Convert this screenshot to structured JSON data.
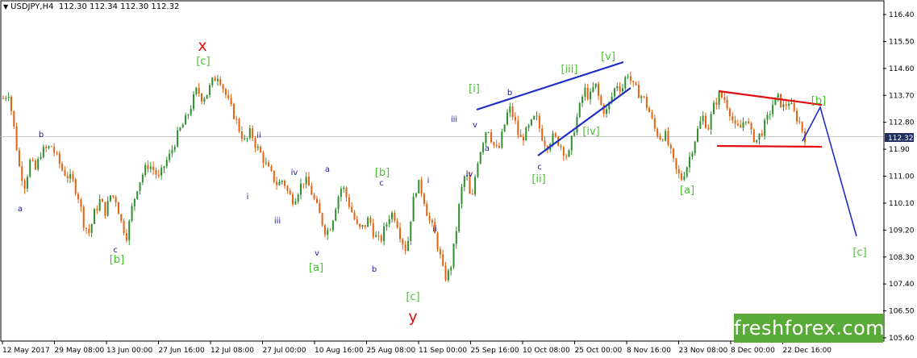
{
  "header": {
    "symbol": "USDJPY,H4",
    "open": "112.30",
    "high": "112.34",
    "low": "112.30",
    "close": "112.32"
  },
  "brand": "freshforex.com",
  "colors": {
    "up_candle": "#2f8f2f",
    "down_candle": "#e3620f",
    "wave_minor": "#1a1aa0",
    "wave_green": "#45c22d",
    "wave_red": "#e01010",
    "trend_blue": "#1d2ec9",
    "trend_red": "#e01010",
    "price_tag_bg": "#1f2d60"
  },
  "chart_data": {
    "type": "candlestick",
    "y_ticks": [
      "116.40",
      "115.50",
      "114.60",
      "113.70",
      "112.80",
      "11.90",
      "111.00",
      "110.10",
      "109.20",
      "108.30",
      "107.40",
      "106.50",
      "105.60"
    ],
    "y_tick_values": [
      116.4,
      115.5,
      114.6,
      113.7,
      112.8,
      111.9,
      111.0,
      110.1,
      109.2,
      108.3,
      107.4,
      106.5,
      105.6
    ],
    "ylim": [
      105.45,
      116.7
    ],
    "x_labels": [
      "12 May 2017",
      "29 May 08:00",
      "13 Jun 00:00",
      "27 Jun 16:00",
      "12 Jul 08:00",
      "27 Jul 00:00",
      "10 Aug 16:00",
      "25 Aug 08:00",
      "11 Sep 00:00",
      "25 Sep 16:00",
      "10 Oct 08:00",
      "25 Oct 00:00",
      "8 Nov 16:00",
      "23 Nov 08:00",
      "8 Dec 00:00",
      "22 Dec 16:00"
    ],
    "current_price": "112.32",
    "price_path": [
      [
        0,
        113.6
      ],
      [
        1,
        113.8
      ],
      [
        2,
        112.6
      ],
      [
        3,
        111.3
      ],
      [
        4,
        110.7
      ],
      [
        5,
        111.5
      ],
      [
        6,
        111.2
      ],
      [
        7,
        111.8
      ],
      [
        8,
        111.9
      ],
      [
        9,
        112.0
      ],
      [
        10,
        111.6
      ],
      [
        11,
        111.2
      ],
      [
        12,
        111.0
      ],
      [
        13,
        110.8
      ],
      [
        14,
        110.3
      ],
      [
        15,
        109.4
      ],
      [
        16,
        109.1
      ],
      [
        17,
        109.8
      ],
      [
        18,
        110.2
      ],
      [
        19,
        109.8
      ],
      [
        20,
        110.4
      ],
      [
        21,
        110.2
      ],
      [
        22,
        109.4
      ],
      [
        23,
        109.0
      ],
      [
        24,
        110.0
      ],
      [
        25,
        110.7
      ],
      [
        26,
        111.1
      ],
      [
        27,
        111.4
      ],
      [
        28,
        111.2
      ],
      [
        29,
        110.9
      ],
      [
        30,
        111.4
      ],
      [
        31,
        111.7
      ],
      [
        32,
        112.2
      ],
      [
        33,
        112.6
      ],
      [
        34,
        112.9
      ],
      [
        35,
        113.4
      ],
      [
        36,
        113.9
      ],
      [
        37,
        113.6
      ],
      [
        38,
        113.8
      ],
      [
        39,
        114.2
      ],
      [
        40,
        114.4
      ],
      [
        41,
        113.9
      ],
      [
        42,
        113.4
      ],
      [
        43,
        113.0
      ],
      [
        44,
        112.5
      ],
      [
        45,
        112.1
      ],
      [
        46,
        112.5
      ],
      [
        47,
        112.0
      ],
      [
        48,
        111.7
      ],
      [
        49,
        111.3
      ],
      [
        50,
        111.0
      ],
      [
        51,
        110.7
      ],
      [
        52,
        110.9
      ],
      [
        53,
        110.4
      ],
      [
        54,
        110.2
      ],
      [
        55,
        110.6
      ],
      [
        56,
        110.9
      ],
      [
        57,
        110.6
      ],
      [
        58,
        110.1
      ],
      [
        59,
        109.6
      ],
      [
        60,
        109.1
      ],
      [
        61,
        109.4
      ],
      [
        62,
        110.2
      ],
      [
        63,
        110.7
      ],
      [
        64,
        110.2
      ],
      [
        65,
        109.7
      ],
      [
        66,
        109.2
      ],
      [
        67,
        109.3
      ],
      [
        68,
        109.6
      ],
      [
        69,
        109.0
      ],
      [
        70,
        108.8
      ],
      [
        71,
        109.3
      ],
      [
        72,
        109.8
      ],
      [
        73,
        109.6
      ],
      [
        74,
        108.9
      ],
      [
        75,
        108.5
      ],
      [
        76,
        110.0
      ],
      [
        77,
        110.8
      ],
      [
        78,
        110.4
      ],
      [
        79,
        109.6
      ],
      [
        80,
        109.2
      ],
      [
        81,
        108.5
      ],
      [
        82,
        107.6
      ],
      [
        83,
        107.8
      ],
      [
        84,
        108.9
      ],
      [
        85,
        110.4
      ],
      [
        86,
        111.2
      ],
      [
        87,
        110.0
      ],
      [
        88,
        111.4
      ],
      [
        89,
        112.1
      ],
      [
        90,
        112.7
      ],
      [
        91,
        112.1
      ],
      [
        92,
        111.8
      ],
      [
        93,
        112.6
      ],
      [
        94,
        113.3
      ],
      [
        95,
        112.9
      ],
      [
        96,
        112.2
      ],
      [
        97,
        112.4
      ],
      [
        98,
        112.7
      ],
      [
        99,
        113.0
      ],
      [
        100,
        112.4
      ],
      [
        101,
        112.0
      ],
      [
        102,
        112.3
      ],
      [
        103,
        112.2
      ],
      [
        104,
        111.9
      ],
      [
        105,
        111.6
      ],
      [
        106,
        112.5
      ],
      [
        107,
        113.2
      ],
      [
        108,
        113.9
      ],
      [
        109,
        113.6
      ],
      [
        110,
        114.1
      ],
      [
        111,
        113.4
      ],
      [
        112,
        113.1
      ],
      [
        113,
        113.6
      ],
      [
        114,
        114.1
      ],
      [
        115,
        113.9
      ],
      [
        116,
        114.5
      ],
      [
        117,
        114.0
      ],
      [
        118,
        113.8
      ],
      [
        119,
        113.6
      ],
      [
        120,
        113.2
      ],
      [
        121,
        112.6
      ],
      [
        122,
        112.3
      ],
      [
        123,
        112.4
      ],
      [
        124,
        111.8
      ],
      [
        125,
        111.2
      ],
      [
        126,
        110.9
      ],
      [
        127,
        111.3
      ],
      [
        128,
        111.9
      ],
      [
        129,
        112.5
      ],
      [
        130,
        113.0
      ],
      [
        131,
        112.6
      ],
      [
        132,
        113.3
      ],
      [
        133,
        113.7
      ],
      [
        134,
        113.6
      ],
      [
        135,
        113.2
      ],
      [
        136,
        112.6
      ],
      [
        137,
        112.6
      ],
      [
        138,
        113.0
      ],
      [
        139,
        112.4
      ],
      [
        140,
        112.2
      ],
      [
        141,
        112.5
      ],
      [
        142,
        112.9
      ],
      [
        143,
        113.4
      ],
      [
        144,
        113.6
      ],
      [
        145,
        113.3
      ],
      [
        146,
        113.5
      ],
      [
        147,
        113.1
      ],
      [
        148,
        112.8
      ],
      [
        149,
        112.3
      ]
    ],
    "projection": [
      [
        995,
        175
      ],
      [
        1017,
        133
      ],
      [
        1062,
        293
      ]
    ],
    "wave_labels": [
      {
        "text": "x",
        "color": "red",
        "x": 251,
        "y": 63
      },
      {
        "text": "y",
        "color": "red",
        "x": 512,
        "y": 399
      },
      {
        "text": "[c]",
        "color": "green",
        "x": 252,
        "y": 80
      },
      {
        "text": "[b]",
        "color": "green",
        "x": 145,
        "y": 326
      },
      {
        "text": "[a]",
        "color": "green",
        "x": 392,
        "y": 336
      },
      {
        "text": "[b]",
        "color": "green",
        "x": 474,
        "y": 218
      },
      {
        "text": "[c]",
        "color": "green",
        "x": 512,
        "y": 372
      },
      {
        "text": "[i]",
        "color": "green",
        "x": 588,
        "y": 114
      },
      {
        "text": "[ii]",
        "color": "green",
        "x": 668,
        "y": 226
      },
      {
        "text": "[iii]",
        "color": "green",
        "x": 706,
        "y": 90
      },
      {
        "text": "[iv]",
        "color": "green",
        "x": 733,
        "y": 167
      },
      {
        "text": "[v]",
        "color": "green",
        "x": 754,
        "y": 74
      },
      {
        "text": "[a]",
        "color": "green",
        "x": 852,
        "y": 240
      },
      {
        "text": "[b]",
        "color": "green",
        "x": 1015,
        "y": 129
      },
      {
        "text": "[c]",
        "color": "green",
        "x": 1066,
        "y": 317
      },
      {
        "text": "a",
        "color": "blue",
        "x": 25,
        "y": 262
      },
      {
        "text": "b",
        "color": "blue",
        "x": 51,
        "y": 170
      },
      {
        "text": "c",
        "color": "blue",
        "x": 143,
        "y": 313
      },
      {
        "text": "i",
        "color": "blue",
        "x": 307,
        "y": 247
      },
      {
        "text": "ii",
        "color": "blue",
        "x": 321,
        "y": 171
      },
      {
        "text": "iii",
        "color": "blue",
        "x": 344,
        "y": 277
      },
      {
        "text": "iv",
        "color": "blue",
        "x": 365,
        "y": 217
      },
      {
        "text": "v",
        "color": "blue",
        "x": 393,
        "y": 317
      },
      {
        "text": "a",
        "color": "blue",
        "x": 406,
        "y": 213
      },
      {
        "text": "b",
        "color": "blue",
        "x": 464,
        "y": 337
      },
      {
        "text": "c",
        "color": "blue",
        "x": 473,
        "y": 230
      },
      {
        "text": "i",
        "color": "blue",
        "x": 531,
        "y": 227
      },
      {
        "text": "ii",
        "color": "blue",
        "x": 539,
        "y": 287
      },
      {
        "text": "iii",
        "color": "blue",
        "x": 563,
        "y": 151
      },
      {
        "text": "iv",
        "color": "blue",
        "x": 582,
        "y": 219
      },
      {
        "text": "v",
        "color": "blue",
        "x": 589,
        "y": 158
      },
      {
        "text": "a",
        "color": "blue",
        "x": 604,
        "y": 187
      },
      {
        "text": "b",
        "color": "blue",
        "x": 632,
        "y": 118
      },
      {
        "text": "c",
        "color": "blue",
        "x": 669,
        "y": 210
      }
    ],
    "trendlines": [
      {
        "color": "blue",
        "x1": 591,
        "y1": 136,
        "x2": 773,
        "y2": 77
      },
      {
        "color": "blue",
        "x1": 667,
        "y1": 193,
        "x2": 782,
        "y2": 109
      },
      {
        "color": "red",
        "x1": 891,
        "y1": 113,
        "x2": 1019,
        "y2": 130
      },
      {
        "color": "red",
        "x1": 889,
        "y1": 181,
        "x2": 1019,
        "y2": 182
      }
    ]
  }
}
